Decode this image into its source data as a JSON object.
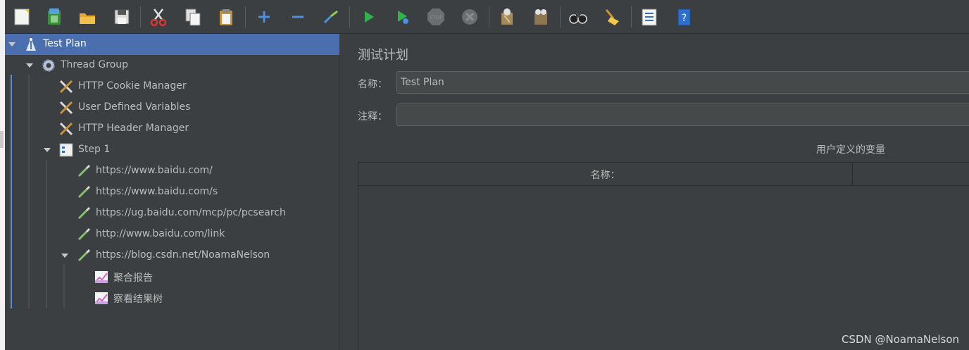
{
  "toolbar": {
    "buttons": [
      {
        "name": "new-icon"
      },
      {
        "name": "templates-icon"
      },
      {
        "name": "open-icon"
      },
      {
        "name": "save-icon"
      },
      {
        "name": "cut-icon"
      },
      {
        "name": "copy-icon"
      },
      {
        "name": "paste-icon"
      },
      {
        "name": "expand-icon"
      },
      {
        "name": "collapse-icon"
      },
      {
        "name": "toggle-icon"
      },
      {
        "name": "start-icon"
      },
      {
        "name": "start-no-pauses-icon"
      },
      {
        "name": "stop-icon",
        "text": "STOP"
      },
      {
        "name": "shutdown-icon"
      },
      {
        "name": "clear-icon"
      },
      {
        "name": "clear-all-icon"
      },
      {
        "name": "search-icon"
      },
      {
        "name": "reset-search-icon"
      },
      {
        "name": "function-helper-icon"
      },
      {
        "name": "help-icon",
        "text": "?"
      }
    ]
  },
  "tree": {
    "items": [
      {
        "label": "Test Plan",
        "icon": "test-plan-icon",
        "selected": true
      },
      {
        "label": "Thread Group",
        "icon": "thread-group-gear-icon"
      },
      {
        "label": "HTTP Cookie Manager",
        "icon": "config-tools-icon"
      },
      {
        "label": "User Defined Variables",
        "icon": "config-tools-icon"
      },
      {
        "label": "HTTP Header Manager",
        "icon": "config-tools-icon"
      },
      {
        "label": "Step 1",
        "icon": "transaction-controller-icon"
      },
      {
        "label": "https://www.baidu.com/",
        "icon": "http-sampler-pipette-icon"
      },
      {
        "label": "https://www.baidu.com/s",
        "icon": "http-sampler-pipette-icon"
      },
      {
        "label": "https://ug.baidu.com/mcp/pc/pcsearch",
        "icon": "http-sampler-pipette-icon"
      },
      {
        "label": "http://www.baidu.com/link",
        "icon": "http-sampler-pipette-icon"
      },
      {
        "label": "https://blog.csdn.net/NoamaNelson",
        "icon": "http-sampler-pipette-icon"
      },
      {
        "label": "聚合报告",
        "icon": "listener-graph-icon"
      },
      {
        "label": "察看结果树",
        "icon": "listener-graph-icon"
      }
    ]
  },
  "panel": {
    "title": "测试计划",
    "name_label": "名称：",
    "name_value": "Test Plan",
    "comment_label": "注释：",
    "comment_value": "",
    "vars_title": "用户定义的变量",
    "vars_col_name": "名称：",
    "vars_col_value": ""
  },
  "watermark": "CSDN @NoamaNelson",
  "colors": {
    "background": "#3c3f41",
    "selection": "#4b6eaf",
    "text": "#bbbbbb",
    "guide_blue": "#5b8cd9"
  }
}
